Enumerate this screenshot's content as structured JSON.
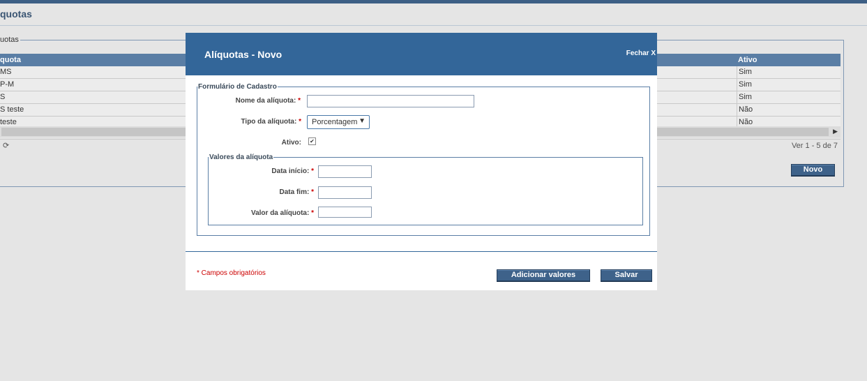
{
  "page": {
    "title": "quotas"
  },
  "list": {
    "legend": "uotas",
    "columns": {
      "name": "quota",
      "active": "Ativo"
    },
    "rows": [
      {
        "name": "MS",
        "active": "Sim"
      },
      {
        "name": "P-M",
        "active": "Sim"
      },
      {
        "name": "S",
        "active": "Sim"
      },
      {
        "name": "S teste",
        "active": "Não"
      },
      {
        "name": "teste",
        "active": "Não"
      }
    ],
    "pager_text": "Ver 1 - 5 de 7",
    "new_button": "Novo"
  },
  "modal": {
    "title": "Alíquotas - Novo",
    "close": "Fechar X",
    "form_legend": "Formulário de Cadastro",
    "name_label": "Nome da alíquota:",
    "name_value": "",
    "type_label": "Tipo da alíquota:",
    "type_value": "Porcentagem",
    "active_label": "Ativo:",
    "active_checked": true,
    "values_legend": "Valores da alíquota",
    "start_label": "Data início:",
    "end_label": "Data fim:",
    "value_label": "Valor da alíquota:",
    "required_mark": "*",
    "required_note": "* Campos obrigatórios",
    "add_values_button": "Adicionar valores",
    "save_button": "Salvar"
  },
  "colors": {
    "header": "#336699",
    "accent_button": "#3e628a",
    "required": "#cc0000"
  }
}
